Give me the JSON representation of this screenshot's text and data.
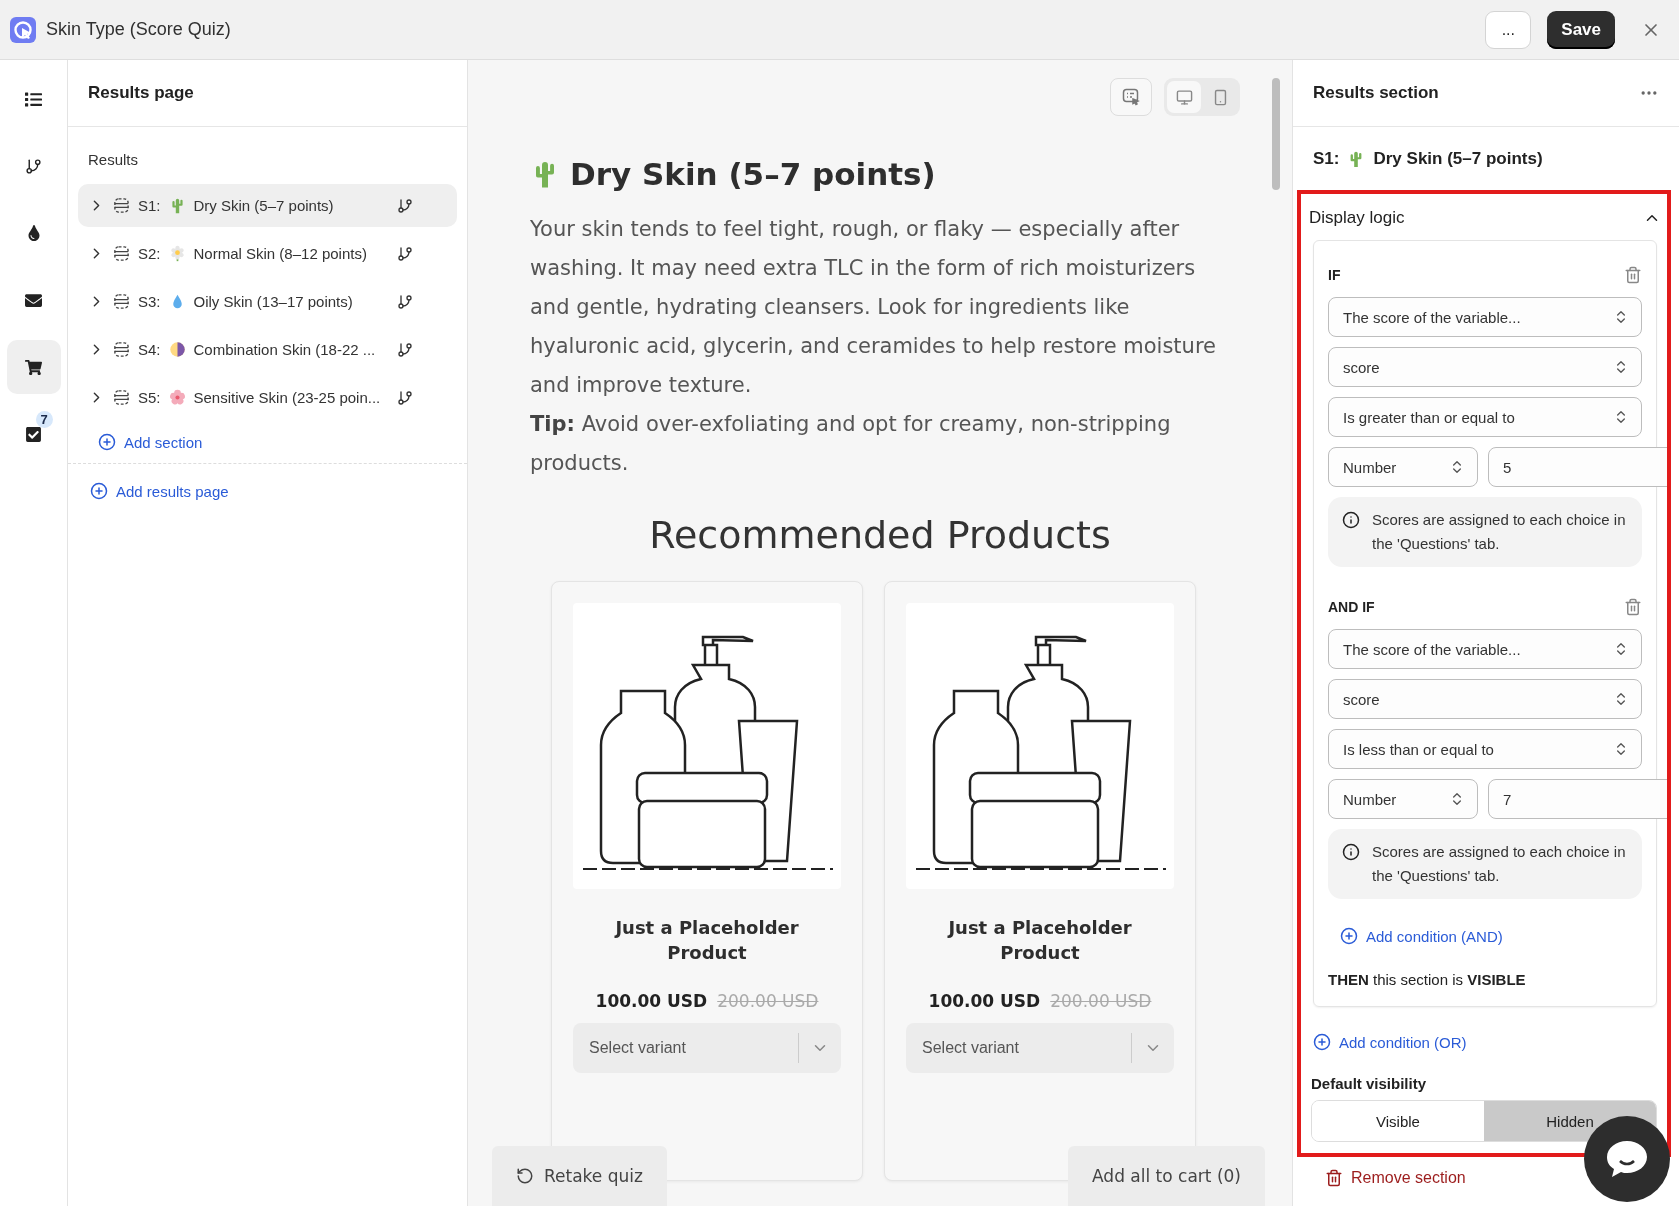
{
  "window": {
    "title": "Skin Type (Score Quiz)"
  },
  "header_actions": {
    "more": "...",
    "save": "Save"
  },
  "rail": [
    {
      "kind": "list",
      "selected": false
    },
    {
      "kind": "branch",
      "selected": false
    },
    {
      "kind": "drop",
      "selected": false
    },
    {
      "kind": "mail",
      "selected": false
    },
    {
      "kind": "cart",
      "selected": true
    },
    {
      "kind": "tasks",
      "selected": false,
      "badge": "7"
    }
  ],
  "sidebar": {
    "title": "Results page",
    "group": "Results",
    "items": [
      {
        "code": "S1:",
        "kind": "cactus",
        "label": "Dry Skin (5–7 points)",
        "selected": true
      },
      {
        "code": "S2:",
        "kind": "daisy",
        "label": "Normal Skin (8–12 points)",
        "selected": false
      },
      {
        "code": "S3:",
        "kind": "droplet",
        "label": "Oily Skin (13–17 points)",
        "selected": false
      },
      {
        "code": "S4:",
        "kind": "half-moon",
        "label": "Combination Skin (18-22 ...",
        "selected": false
      },
      {
        "code": "S5:",
        "kind": "blossom",
        "label": "Sensitive Skin (23-25 poin...",
        "selected": false
      }
    ],
    "add_section": "Add section",
    "add_results_page": "Add results page"
  },
  "preview": {
    "device_toggle": [
      {
        "kind": "desktop",
        "selected": true
      },
      {
        "kind": "mobile",
        "selected": false
      }
    ],
    "heading": {
      "kind": "cactus",
      "text": "Dry Skin (5–7 points)"
    },
    "body": "Your skin tends to feel tight, rough, or flaky — especially after washing. It may need extra TLC in the form of rich moisturizers and gentle, hydrating cleansers. Look for ingredients like hyaluronic acid, glycerin, and ceramides to help restore moisture and improve texture.",
    "tip": "**Tip:** Avoid over-exfoliating and opt for creamy, non-stripping products.",
    "products_title": "Recommended Products",
    "products": [
      {
        "name": "Just a Placeholder Product",
        "price": "100.00 USD",
        "compare_price": "200.00 USD",
        "variant_placeholder": "Select variant"
      },
      {
        "name": "Just a Placeholder Product",
        "price": "100.00 USD",
        "compare_price": "200.00 USD",
        "variant_placeholder": "Select variant"
      }
    ],
    "retake": "Retake quiz",
    "add_all": "Add all to cart (0)"
  },
  "panel": {
    "title": "Results section",
    "section": {
      "code": "S1:",
      "kind": "cactus",
      "label": "Dry Skin (5–7 points)"
    },
    "display_logic": {
      "title": "Display logic",
      "expanded": true,
      "conditions": [
        {
          "heading": "IF",
          "subject": "The score of the variable...",
          "variable": "score",
          "operator": "Is greater than or equal to",
          "value_type": "Number",
          "value": "5",
          "note": "Scores are assigned to each choice in the 'Questions' tab."
        },
        {
          "heading": "AND IF",
          "subject": "The score of the variable...",
          "variable": "score",
          "operator": "Is less than or equal to",
          "value_type": "Number",
          "value": "7",
          "note": "Scores are assigned to each choice in the 'Questions' tab."
        }
      ],
      "add_and": "Add condition (AND)",
      "then": "**THEN** this section is **VISIBLE**",
      "add_or": "Add condition (OR)"
    },
    "default_visibility": {
      "title": "Default visibility",
      "options": [
        {
          "label": "Visible",
          "selected": false
        },
        {
          "label": "Hidden",
          "selected": true
        }
      ]
    },
    "remove": "Remove section"
  }
}
